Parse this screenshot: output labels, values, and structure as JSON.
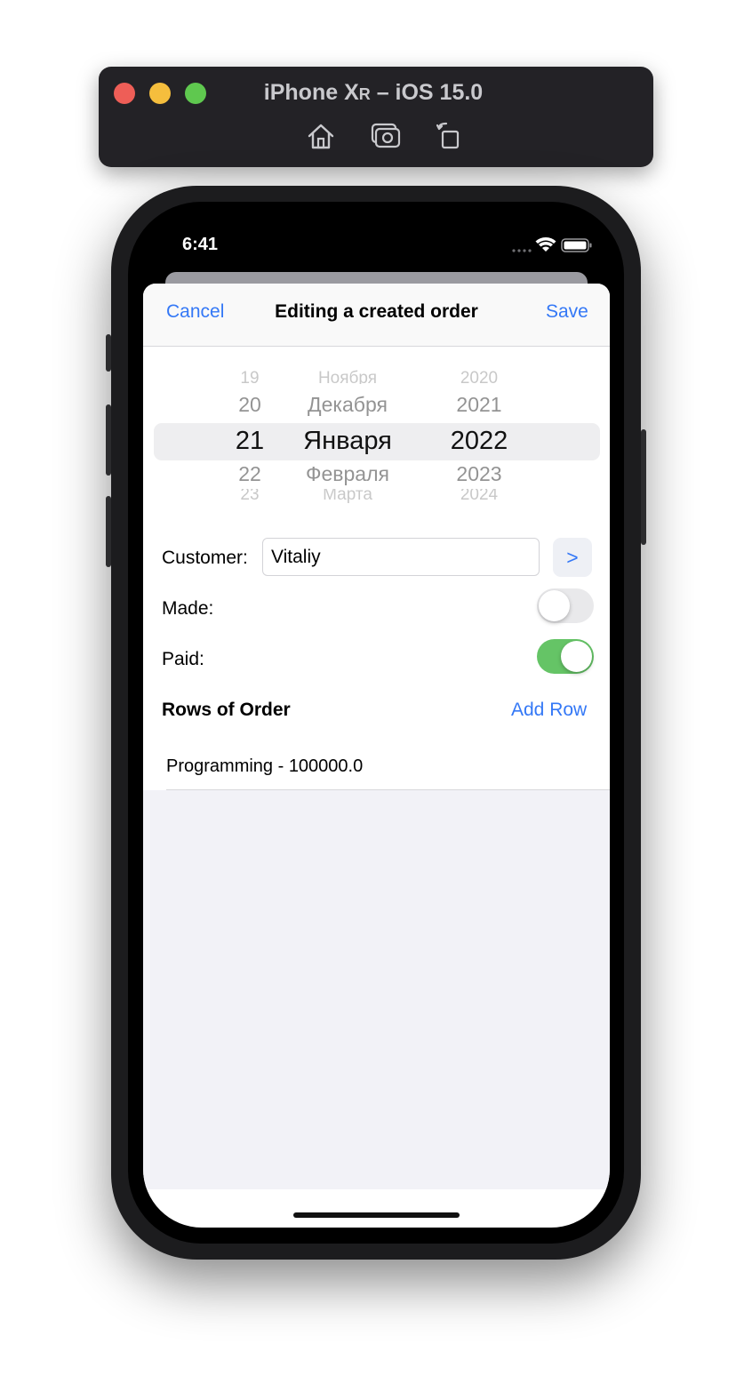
{
  "simulator": {
    "title": "iPhone X",
    "title_suffix_small": "R",
    "title_tail": " – iOS 15.0",
    "tools": [
      "home-icon",
      "screenshot-icon",
      "rotate-icon"
    ]
  },
  "status_bar": {
    "time": "6:41",
    "icons": [
      "cellular-icon",
      "wifi-icon",
      "battery-icon"
    ]
  },
  "navbar": {
    "cancel": "Cancel",
    "title": "Editing a created order",
    "save": "Save"
  },
  "date_picker": {
    "days": [
      "19",
      "20",
      "21",
      "22",
      "23"
    ],
    "months": [
      "Ноября",
      "Декабря",
      "Января",
      "Февраля",
      "Марта"
    ],
    "years": [
      "2020",
      "2021",
      "2022",
      "2023",
      "2024"
    ],
    "selected": {
      "day": "21",
      "month": "Января",
      "year": "2022"
    }
  },
  "form": {
    "customer_label": "Customer:",
    "customer_value": "Vitaliy",
    "select_button": ">",
    "made_label": "Made:",
    "made_on": false,
    "paid_label": "Paid:",
    "paid_on": true
  },
  "rows": {
    "title": "Rows of Order",
    "add_label": "Add Row",
    "items": [
      {
        "text": "Programming  - 100000.0"
      }
    ]
  },
  "colors": {
    "accent": "#3478f6",
    "toggle_on": "#65c466",
    "toggle_off": "#e9e9eb",
    "grouped_background": "#f2f2f7"
  }
}
